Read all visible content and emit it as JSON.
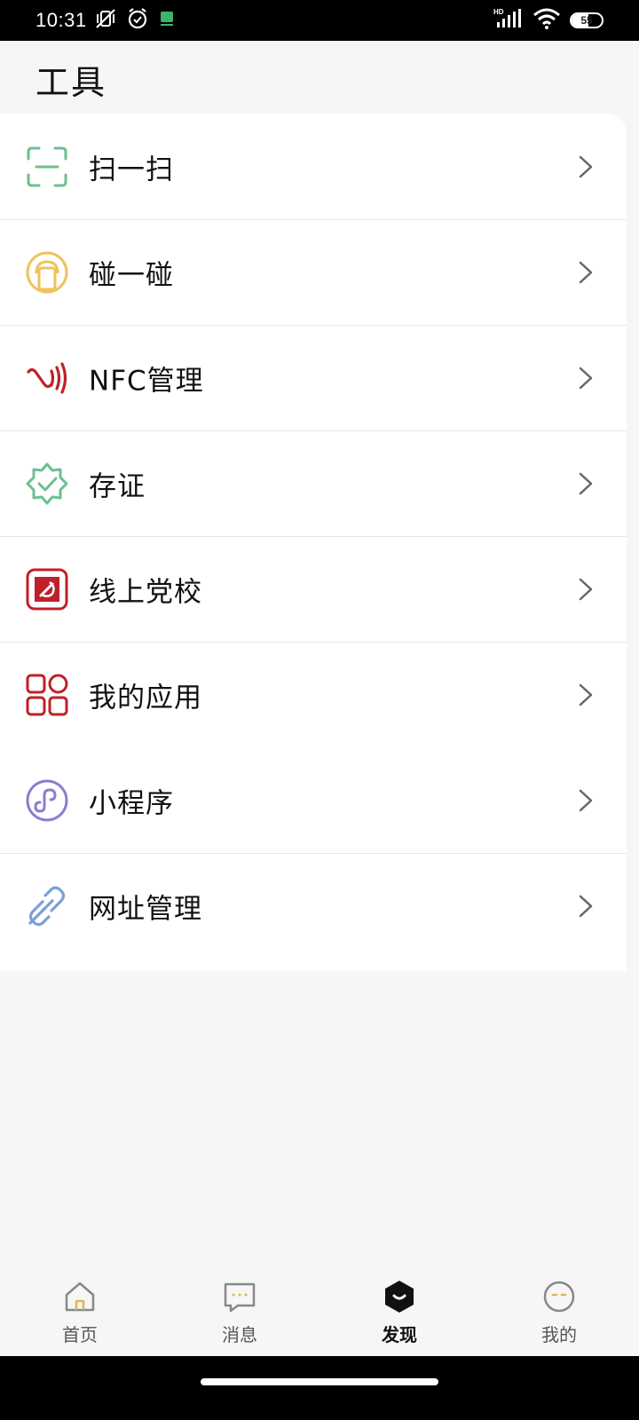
{
  "status_bar": {
    "time": "10:31",
    "network": "HD",
    "battery_level": "55",
    "icons": [
      "vibrate-mute-icon",
      "alarm-icon",
      "notification-app-icon",
      "signal-icon",
      "wifi-icon",
      "battery-icon"
    ]
  },
  "page": {
    "title": "工具"
  },
  "tools": [
    {
      "label": "扫一扫",
      "icon": "scan-icon",
      "color": "#6cc08f"
    },
    {
      "label": "碰一碰",
      "icon": "tap-phone-icon",
      "color": "#f0c25c"
    },
    {
      "label": "NFC管理",
      "icon": "nfc-icon",
      "color": "#c0202a"
    },
    {
      "label": "存证",
      "icon": "certificate-badge-icon",
      "color": "#6cc08f"
    },
    {
      "label": "线上党校",
      "icon": "party-school-icon",
      "color": "#c0202a"
    },
    {
      "label": "我的应用",
      "icon": "apps-grid-icon",
      "color": "#c0202a"
    },
    {
      "label": "小程序",
      "icon": "mini-program-icon",
      "color": "#8a7fd0"
    },
    {
      "label": "网址管理",
      "icon": "link-icon",
      "color": "#7a9fd8"
    }
  ],
  "tab_bar": {
    "tabs": [
      {
        "label": "首页",
        "icon": "home-icon",
        "active": false
      },
      {
        "label": "消息",
        "icon": "message-icon",
        "active": false
      },
      {
        "label": "发现",
        "icon": "discover-icon",
        "active": true
      },
      {
        "label": "我的",
        "icon": "profile-icon",
        "active": false
      }
    ]
  },
  "colors": {
    "background": "#f6f6f6",
    "card": "#ffffff",
    "divider": "#e6e6e6",
    "tab_icon_accent": "#e0b84a"
  }
}
